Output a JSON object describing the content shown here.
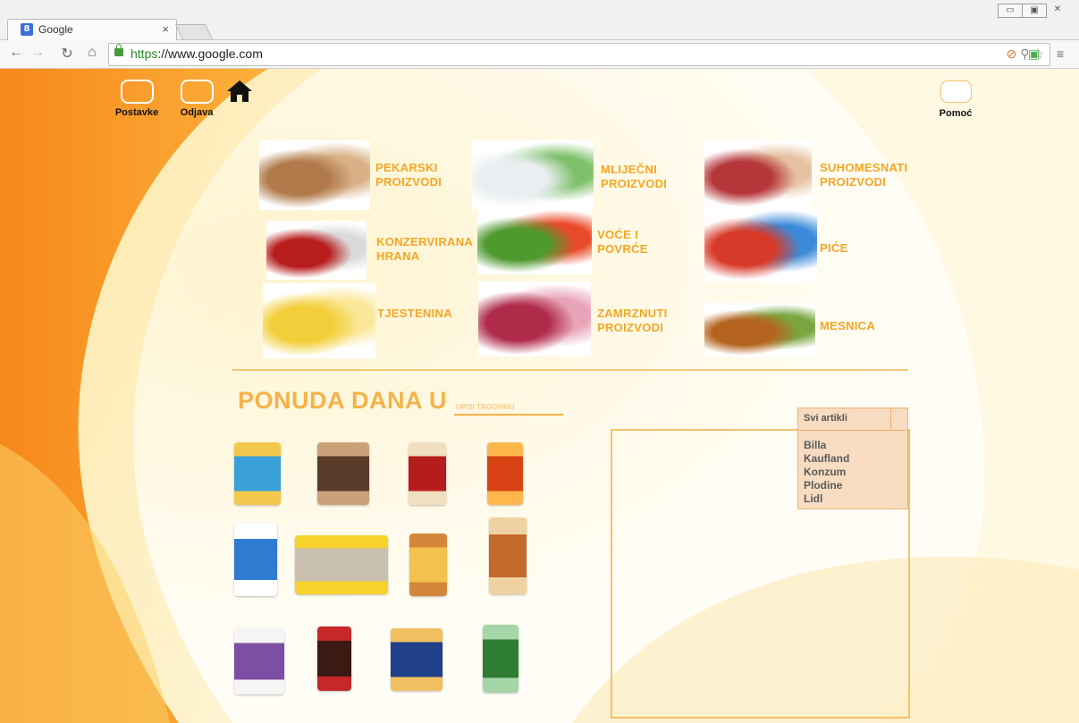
{
  "browser": {
    "tab_title": "Google",
    "tab_close": "×",
    "url_scheme": "https",
    "url_rest": "://www.google.com",
    "window_controls": [
      "▭",
      "▣",
      "✕"
    ]
  },
  "nav": {
    "settings_label": "Postavke",
    "logout_label": "Odjava",
    "help_label": "Pomoć"
  },
  "categories": [
    {
      "label": "PEKARSKI PROIZVODI",
      "icon": "bread-image"
    },
    {
      "label": "MLIJEČNI PROIZVODI",
      "icon": "dairy-image"
    },
    {
      "label": "SUHOMESNATI PROIZVODI",
      "icon": "cured-meat-image"
    },
    {
      "label": "KONZERVIRANA HRANA",
      "icon": "canned-food-image"
    },
    {
      "label": "VOĆE I POVRĆE",
      "icon": "fruit-vegetables-image"
    },
    {
      "label": "PIĆE",
      "icon": "drinks-image"
    },
    {
      "label": "TJESTENINA",
      "icon": "pasta-image"
    },
    {
      "label": "ZAMRZNUTI PROIZVODI",
      "icon": "frozen-berries-image"
    },
    {
      "label": "MESNICA",
      "icon": "roast-chicken-image"
    }
  ],
  "offer": {
    "title": "PONUDA DANA U",
    "store_placeholder": "UPISI TRGOVINU"
  },
  "store_select": {
    "selected": "Svi artikli",
    "options": [
      "Billa",
      "Kaufland",
      "Konzum",
      "Plodine",
      "Lidl"
    ]
  },
  "colors": {
    "accent": "#f5a623",
    "orange_bg": "#f7941d",
    "panel_border": "#f5c06a",
    "dropdown_bg": "#f8dcc1"
  }
}
